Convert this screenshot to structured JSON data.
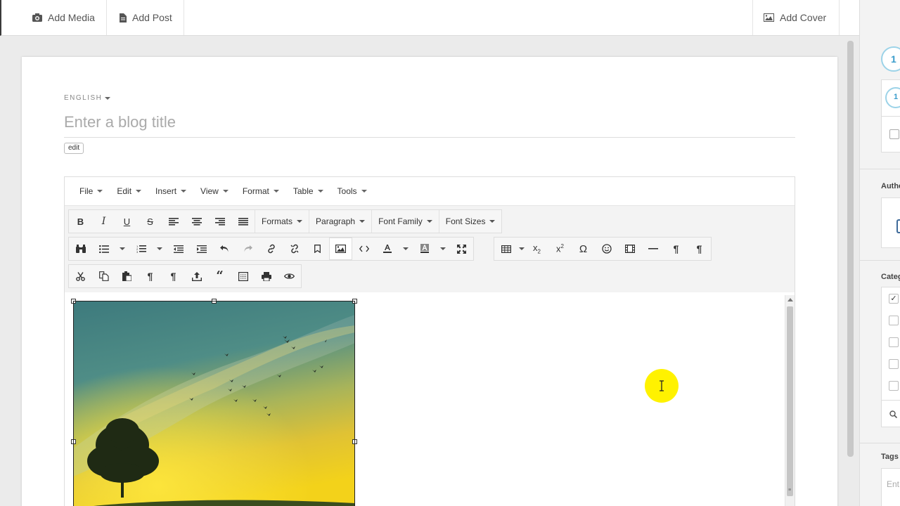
{
  "topbar": {
    "add_media": "Add Media",
    "add_post": "Add Post",
    "add_cover": "Add Cover"
  },
  "form": {
    "language": "ENGLISH",
    "title_placeholder": "Enter a blog title",
    "edit_label": "edit"
  },
  "menubar": [
    "File",
    "Edit",
    "Insert",
    "View",
    "Format",
    "Table",
    "Tools"
  ],
  "toolbar": {
    "formats": "Formats",
    "paragraph": "Paragraph",
    "font_family": "Font Family",
    "font_sizes": "Font Sizes"
  },
  "sidebar": {
    "step_number": "1",
    "step_number_2": "1",
    "author_label": "Autho",
    "categories_label": "Categ",
    "tags_label": "Tags",
    "tags_placeholder": "Ent"
  },
  "colors": {
    "accent_circle": "#9cd3e8",
    "cursor_highlight": "#fff200"
  }
}
